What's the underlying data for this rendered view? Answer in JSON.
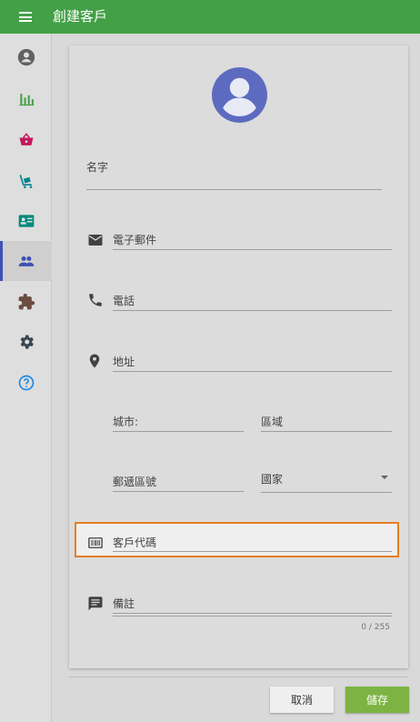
{
  "header": {
    "title": "創建客戶"
  },
  "sidebar": {
    "items": [
      {
        "icon": "account-circle-icon"
      },
      {
        "icon": "bar-chart-icon"
      },
      {
        "icon": "shopping-basket-icon"
      },
      {
        "icon": "cart-icon"
      },
      {
        "icon": "contact-card-icon"
      },
      {
        "icon": "people-icon",
        "active": true
      },
      {
        "icon": "puzzle-icon"
      },
      {
        "icon": "settings-icon"
      },
      {
        "icon": "help-icon"
      }
    ]
  },
  "form": {
    "name_label": "名字",
    "email_label": "電子郵件",
    "phone_label": "電話",
    "address_label": "地址",
    "city_label": "城市:",
    "region_label": "區域",
    "postal_label": "郵遞區號",
    "country_label": "國家",
    "customer_code_label": "客戶代碼",
    "notes_label": "備註",
    "notes_counter": "0 / 255"
  },
  "buttons": {
    "cancel": "取消",
    "save": "儲存"
  },
  "colors": {
    "header": "#43a047",
    "accent": "#3f51b5",
    "save": "#7cb342",
    "highlight": "#e67e22"
  }
}
